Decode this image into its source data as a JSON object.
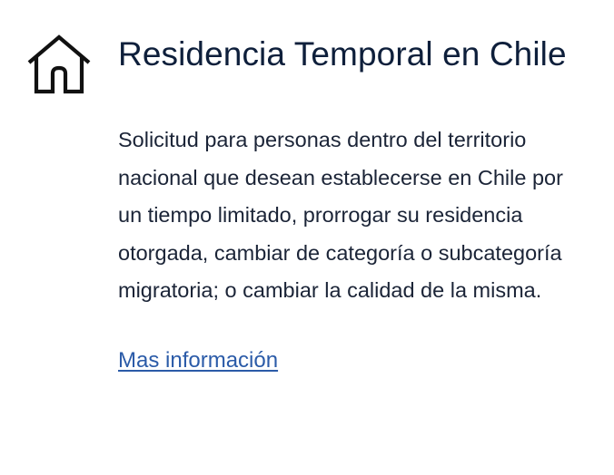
{
  "card": {
    "icon": "home-icon",
    "title": "Residencia Temporal en Chile",
    "description": "Solicitud para personas dentro del territorio nacional que desean establecerse en Chile por un tiempo limitado, prorrogar su residencia otorgada, cambiar de categoría o subcategoría migratoria; o cambiar la calidad de la misma.",
    "link_label": "Mas información"
  },
  "colors": {
    "title": "#0e1f3b",
    "text": "#1b2437",
    "link": "#2b5ba8",
    "icon": "#111111"
  }
}
